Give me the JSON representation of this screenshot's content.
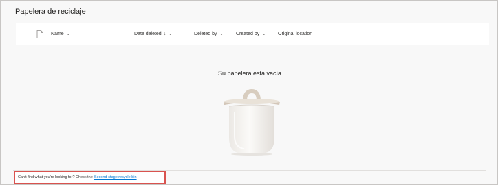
{
  "page": {
    "title": "Papelera de reciclaje"
  },
  "table": {
    "columns": [
      {
        "label": "Name",
        "indicator": "chevron-down"
      },
      {
        "label": "Date deleted",
        "indicator": "sort-down-arrow"
      },
      {
        "label": "Deleted by",
        "indicator": "chevron-down"
      },
      {
        "label": "Created by",
        "indicator": "chevron-down"
      },
      {
        "label": "Original location"
      }
    ],
    "file_type_icon": "file-icon"
  },
  "empty_state": {
    "message": "Su papelera está vacía",
    "illustration": "recycle-bin-illustration"
  },
  "footer": {
    "text": "Can't find what you're looking for? Check the",
    "link_label": "Second-stage recycle bin"
  }
}
